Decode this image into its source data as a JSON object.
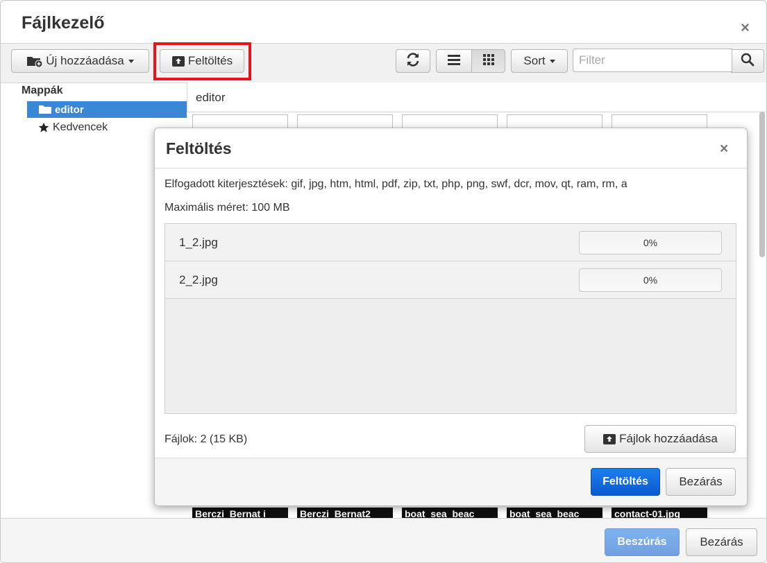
{
  "window": {
    "title": "Fájlkezelő",
    "close_glyph": "×"
  },
  "toolbar": {
    "add_new_label": "Új hozzáadása",
    "upload_label": "Feltöltés",
    "sort_label": "Sort",
    "filter_placeholder": "Filter",
    "icons": [
      "folder-add-icon",
      "upload-icon",
      "refresh-icon",
      "list-view-icon",
      "grid-view-icon",
      "search-icon"
    ],
    "highlight_color": "#e8141b"
  },
  "sidebar": {
    "title": "Mappák",
    "items": [
      {
        "label": "editor",
        "selected": true,
        "icon": "folder-icon"
      },
      {
        "label": "Kedvencek",
        "selected": false,
        "icon": "star-icon"
      }
    ],
    "selected_color": "#3a87d6"
  },
  "main": {
    "path": "editor",
    "thumbnails": [
      {
        "label": "Berczi_Bernat i"
      },
      {
        "label": "Berczi_Bernat2"
      },
      {
        "label": "boat_sea_beac"
      },
      {
        "label": "boat_sea_beac"
      },
      {
        "label": "contact-01.jpg"
      }
    ]
  },
  "upload_dialog": {
    "title": "Feltöltés",
    "close_glyph": "×",
    "accepted_label": "Elfogadott kiterjesztések: gif, jpg, htm, html, pdf, zip, txt, php, png, swf, dcr, mov, qt, ram, rm, a",
    "max_size_label": "Maximális méret: 100 MB",
    "files": [
      {
        "name": "1_2.jpg",
        "progress": 0,
        "progress_label": "0%"
      },
      {
        "name": "2_2.jpg",
        "progress": 0,
        "progress_label": "0%"
      }
    ],
    "files_summary": "Fájlok: 2 (15 KB)",
    "add_files_label": "Fájlok hozzáadása",
    "upload_button_label": "Feltöltés",
    "close_button_label": "Bezárás"
  },
  "footer": {
    "insert_label": "Beszúrás",
    "close_label": "Bezárás"
  }
}
